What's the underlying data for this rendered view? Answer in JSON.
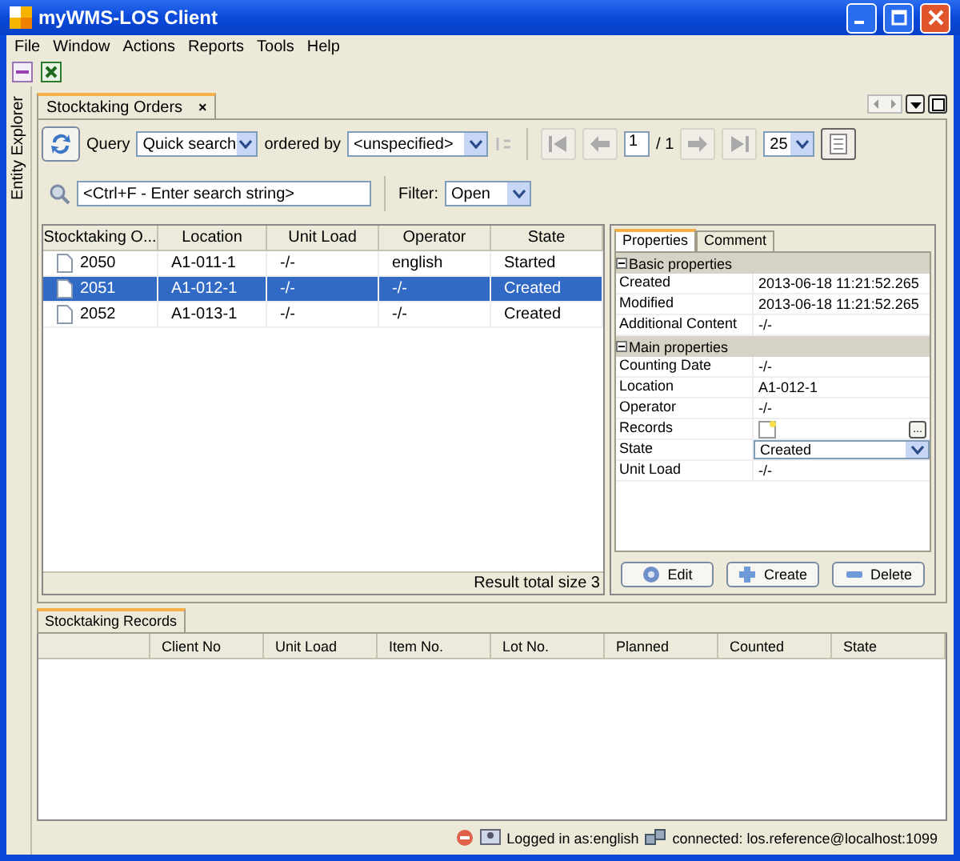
{
  "window": {
    "title": "myWMS-LOS Client"
  },
  "menu": [
    "File",
    "Window",
    "Actions",
    "Reports",
    "Tools",
    "Help"
  ],
  "side_tab": "Entity Explorer",
  "document_tab": {
    "label": "Stocktaking Orders",
    "close": "×"
  },
  "query": {
    "label": "Query",
    "mode": "Quick search",
    "ordered_by_label": "ordered by",
    "ordered_by": "<unspecified>",
    "page": "1",
    "page_total": "/ 1",
    "page_size": "25"
  },
  "search": {
    "placeholder": "<Ctrl+F - Enter search string>",
    "filter_label": "Filter:",
    "filter": "Open"
  },
  "orders": {
    "columns": [
      "Stocktaking O...",
      "Location",
      "Unit Load",
      "Operator",
      "State"
    ],
    "rows": [
      {
        "cells": [
          "2050",
          "A1-011-1",
          "-/-",
          "english",
          "Started"
        ],
        "selected": false
      },
      {
        "cells": [
          "2051",
          "A1-012-1",
          "-/-",
          "-/-",
          "Created"
        ],
        "selected": true
      },
      {
        "cells": [
          "2052",
          "A1-013-1",
          "-/-",
          "-/-",
          "Created"
        ],
        "selected": false
      }
    ],
    "result": "Result total size 3"
  },
  "properties": {
    "tabs": [
      {
        "label": "Properties",
        "selected": true
      },
      {
        "label": "Comment",
        "selected": false
      }
    ],
    "groups": [
      {
        "title": "Basic properties",
        "expanded": true,
        "rows": [
          {
            "label": "Created",
            "value": "2013-06-18 11:21:52.265",
            "kind": "text"
          },
          {
            "label": "Modified",
            "value": "2013-06-18 11:21:52.265",
            "kind": "text"
          },
          {
            "label": "Additional Content",
            "value": "-/-",
            "kind": "text"
          }
        ]
      },
      {
        "title": "Main properties",
        "expanded": true,
        "rows": [
          {
            "label": "Counting Date",
            "value": "-/-",
            "kind": "text"
          },
          {
            "label": "Location",
            "value": "A1-012-1",
            "kind": "text"
          },
          {
            "label": "Operator",
            "value": "-/-",
            "kind": "text"
          },
          {
            "label": "Records",
            "value": "...",
            "kind": "records"
          },
          {
            "label": "State",
            "value": "Created",
            "kind": "select"
          },
          {
            "label": "Unit Load",
            "value": "-/-",
            "kind": "text"
          }
        ]
      }
    ],
    "buttons": [
      {
        "label": "Edit",
        "kind": "edit"
      },
      {
        "label": "Create",
        "kind": "create"
      },
      {
        "label": "Delete",
        "kind": "delete"
      }
    ]
  },
  "records": {
    "tab": "Stocktaking Records",
    "columns": [
      "Client No",
      "Unit Load",
      "Item No.",
      "Lot No.",
      "Planned",
      "Counted",
      "State"
    ]
  },
  "status": {
    "user": "Logged in as:english",
    "connection": "connected: los.reference@localhost:1099"
  }
}
